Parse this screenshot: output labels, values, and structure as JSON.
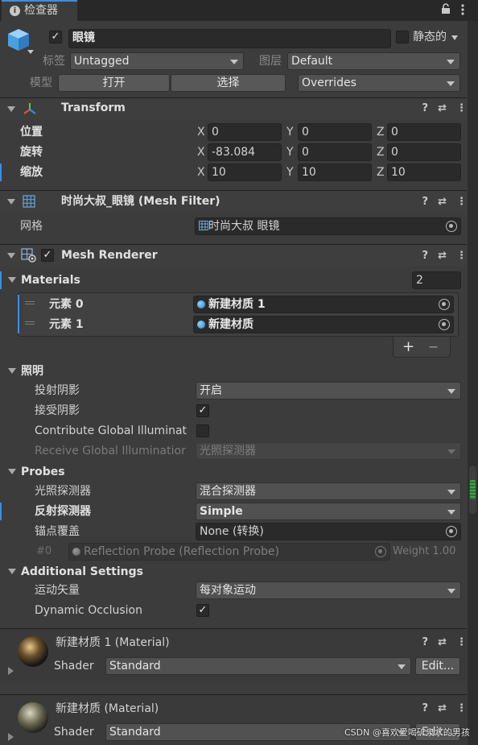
{
  "tab": {
    "title": "检查器",
    "lock_icon": "lock-icon",
    "more_icon": "kebab-menu-icon"
  },
  "object": {
    "active": true,
    "name": "眼镜",
    "static_label": "静态的",
    "static_checked": false
  },
  "tag": {
    "label": "标签",
    "value": "Untagged"
  },
  "layer": {
    "label": "图层",
    "value": "Default"
  },
  "model": {
    "label": "模型",
    "open": "打开",
    "select": "选择",
    "overrides": "Overrides"
  },
  "transform": {
    "title": "Transform",
    "position": {
      "label": "位置",
      "x": "0",
      "y": "0",
      "z": "0"
    },
    "rotation": {
      "label": "旋转",
      "x": "-83.084",
      "y": "0",
      "z": "0"
    },
    "scale": {
      "label": "缩放",
      "x": "10",
      "y": "10",
      "z": "10"
    },
    "axes": {
      "x": "X",
      "y": "Y",
      "z": "Z"
    }
  },
  "mesh_filter": {
    "title": "时尚大叔_眼镜 (Mesh Filter)",
    "mesh_label": "网格",
    "mesh_value": "时尚大叔 眼镜"
  },
  "mesh_renderer": {
    "title": "Mesh Renderer",
    "enabled": true,
    "materials_label": "Materials",
    "materials_count": "2",
    "elements": [
      {
        "label": "元素 0",
        "value": "新建材质 1"
      },
      {
        "label": "元素 1",
        "value": "新建材质"
      }
    ],
    "plus": "+",
    "minus": "−",
    "lighting": {
      "label": "照明",
      "cast_shadows_label": "投射阴影",
      "cast_shadows_value": "开启",
      "receive_shadows_label": "接受阴影",
      "receive_shadows_checked": true,
      "contribute_gi_label": "Contribute Global Illuminat",
      "contribute_gi_checked": false,
      "receive_gi_label": "Receive Global Illuminatior",
      "receive_gi_value": "光照探测器"
    },
    "probes": {
      "label": "Probes",
      "light_probes_label": "光照探测器",
      "light_probes_value": "混合探测器",
      "reflection_probes_label": "反射探测器",
      "reflection_probes_value": "Simple",
      "anchor_label": "锚点覆盖",
      "anchor_value": "None (转换)",
      "probe_index": "#0",
      "probe_value": "Reflection Probe (Reflection Probe)",
      "weight": "Weight 1.00"
    },
    "additional": {
      "label": "Additional Settings",
      "motion_vectors_label": "运动矢量",
      "motion_vectors_value": "每对象运动",
      "dynamic_occlusion_label": "Dynamic Occlusion",
      "dynamic_occlusion_checked": true
    }
  },
  "materials": [
    {
      "title": "新建材质 1 (Material)",
      "shader_label": "Shader",
      "shader_value": "Standard",
      "edit": "Edit..."
    },
    {
      "title": "新建材质 (Material)",
      "shader_label": "Shader",
      "shader_value": "Standard",
      "edit": "Edit..."
    }
  ],
  "watermark": "CSDN @喜欢爱喝矿泉水的男孩",
  "colors": {
    "accent": "#3a8ee6",
    "background": "#3c3c3c",
    "field": "#2a2a2a",
    "scrollbar_thumb": "#3fa34d"
  }
}
